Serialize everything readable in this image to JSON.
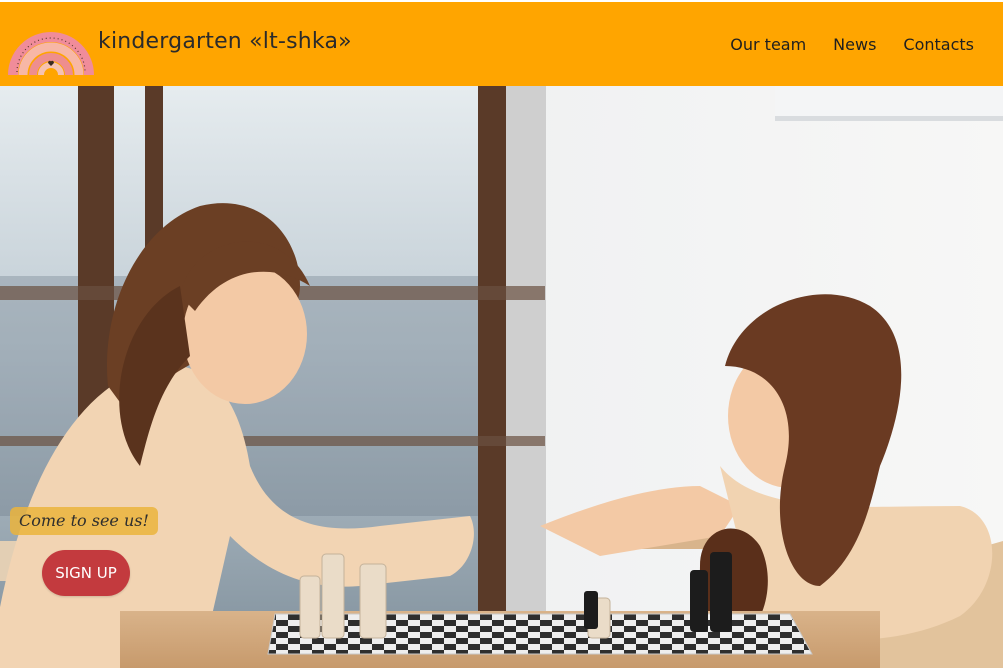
{
  "header": {
    "brand": "kindergarten «lt-shka»",
    "nav": [
      {
        "label": "Our team"
      },
      {
        "label": "News"
      },
      {
        "label": "Contacts"
      }
    ]
  },
  "hero": {
    "tagline": "Come to see us!",
    "cta_label": "SIGN UP",
    "image_subject": "two girls playing chess at a wooden table by a window"
  },
  "colors": {
    "header_bg": "#FFA500",
    "cta_bg": "#C33A3E",
    "tagline_bg": "#EBB43C"
  },
  "icons": {
    "logo": "rainbow-logo-icon"
  }
}
